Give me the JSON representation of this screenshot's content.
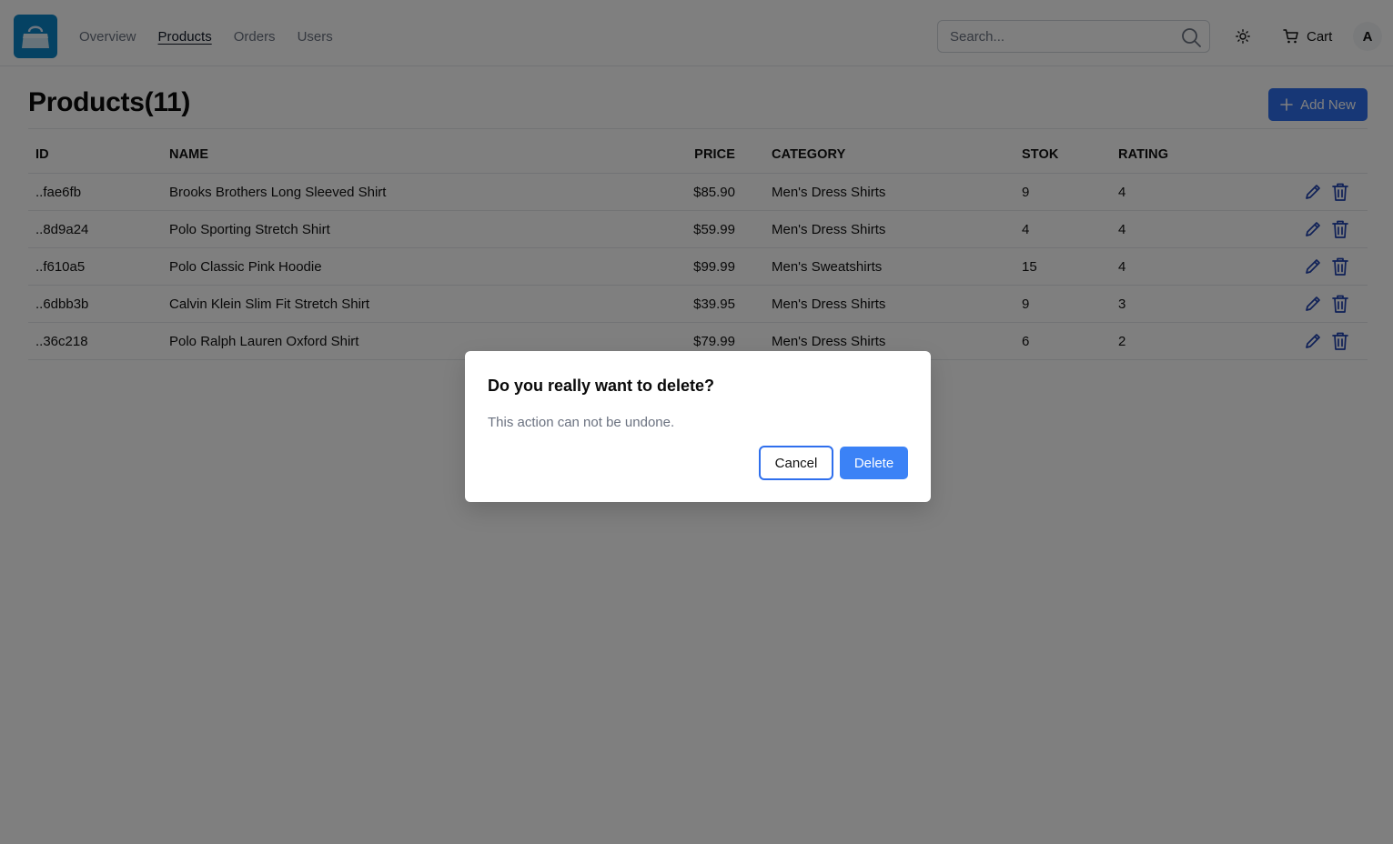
{
  "colors": {
    "accent": "#2f6fed",
    "logo_bg": "#0b84c6",
    "icon_blue": "#1e40af",
    "overlay": "rgba(0,0,0,0.5)"
  },
  "nav": {
    "logo_icon": "shopping-bag-icon",
    "links": [
      {
        "label": "Overview",
        "active": false
      },
      {
        "label": "Products",
        "active": true
      },
      {
        "label": "Orders",
        "active": false
      },
      {
        "label": "Users",
        "active": false
      }
    ],
    "search": {
      "placeholder": "Search...",
      "value": "",
      "icon": "search-icon"
    },
    "theme_icon": "sun-icon",
    "cart": {
      "label": "Cart",
      "icon": "cart-icon"
    },
    "avatar_initial": "A"
  },
  "page": {
    "title": "Products(11)",
    "add_button": {
      "label": "Add New",
      "icon": "plus-icon"
    }
  },
  "table": {
    "headers": {
      "id": "ID",
      "name": "NAME",
      "price": "PRICE",
      "category": "CATEGORY",
      "stock": "STOK",
      "rating": "RATING"
    },
    "rows": [
      {
        "id": "..fae6fb",
        "name": "Brooks Brothers Long Sleeved Shirt",
        "price": "$85.90",
        "category": "Men's Dress Shirts",
        "stock": "9",
        "rating": "4"
      },
      {
        "id": "..8d9a24",
        "name": "Polo Sporting Stretch Shirt",
        "price": "$59.99",
        "category": "Men's Dress Shirts",
        "stock": "4",
        "rating": "4"
      },
      {
        "id": "..f610a5",
        "name": "Polo Classic Pink Hoodie",
        "price": "$99.99",
        "category": "Men's Sweatshirts",
        "stock": "15",
        "rating": "4"
      },
      {
        "id": "..6dbb3b",
        "name": "Calvin Klein Slim Fit Stretch Shirt",
        "price": "$39.95",
        "category": "Men's Dress Shirts",
        "stock": "9",
        "rating": "3"
      },
      {
        "id": "..36c218",
        "name": "Polo Ralph Lauren Oxford Shirt",
        "price": "$79.99",
        "category": "Men's Dress Shirts",
        "stock": "6",
        "rating": "2"
      }
    ],
    "row_actions": {
      "edit_icon": "pencil-icon",
      "delete_icon": "trash-icon"
    }
  },
  "dialog": {
    "title": "Do you really want to delete?",
    "description": "This action can not be undone.",
    "cancel_label": "Cancel",
    "delete_label": "Delete"
  }
}
